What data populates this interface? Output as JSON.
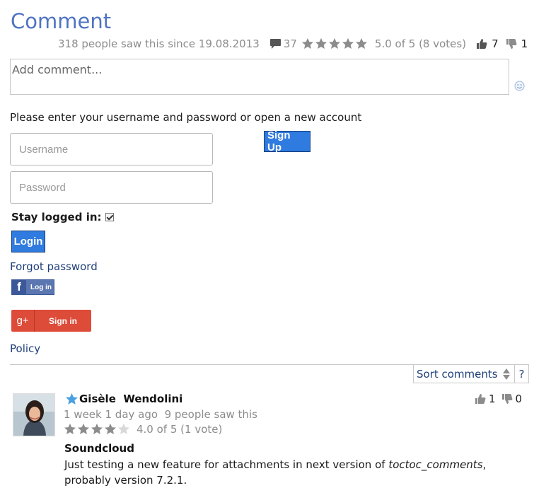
{
  "header": {
    "title": "Comment",
    "seen_text": "318 people saw this since 19.08.2013",
    "comment_count": "37",
    "rating_text": "5.0 of 5 (8 votes)",
    "rating_stars_filled": 5,
    "likes": "7",
    "dislikes": "1"
  },
  "form": {
    "comment_placeholder": "Add comment...",
    "prompt": "Please enter your username and password or open a new account",
    "username_placeholder": "Username",
    "password_placeholder": "Password",
    "signup_label": "Sign Up",
    "stay_logged_label": "Stay logged in:",
    "stay_logged_checked": true,
    "login_label": "Login",
    "forgot_label": "Forgot password",
    "facebook_label": "Log in",
    "google_label": "Sign in",
    "policy_label": "Policy"
  },
  "sort": {
    "label": "Sort comments",
    "help": "?"
  },
  "comments": [
    {
      "author": "Gisèle  Wendolini",
      "meta": "1 week 1 day ago  9 people saw this",
      "rating_text": "4.0 of 5 (1 vote)",
      "rating_stars_filled": 4,
      "title": "Soundcloud",
      "body_pre": "Just testing a new feature for attachments in next version of ",
      "body_em": "toctoc_comments",
      "body_post": ", probably version 7.2.1.",
      "likes": "1",
      "dislikes": "0"
    }
  ],
  "colors": {
    "title": "#4f73c4",
    "button_blue": "#2f7bdf",
    "google_red": "#dd4b39",
    "facebook_blue": "#3b5998",
    "muted_text": "#8c8c8c"
  }
}
